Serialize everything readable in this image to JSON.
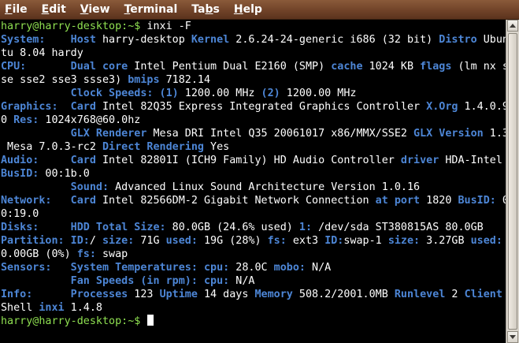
{
  "menu": {
    "items": [
      {
        "mnemonic": "F",
        "rest": "ile"
      },
      {
        "mnemonic": "E",
        "rest": "dit"
      },
      {
        "mnemonic": "V",
        "rest": "iew"
      },
      {
        "mnemonic": "T",
        "rest": "erminal"
      },
      {
        "mnemonic": "Tab",
        "rest": "s",
        "pre": "Ta",
        "ul": "b",
        "post": "s"
      },
      {
        "mnemonic": "H",
        "rest": "elp"
      }
    ]
  },
  "colors": {
    "background": "#000000",
    "text": "#ffffff",
    "key": "#4d86d6",
    "prompt": "#8fe051",
    "menubar": "#6e4127"
  },
  "terminal": {
    "lines": [
      [
        [
          "g",
          "harry@harry-desktop:~$"
        ],
        [
          "w",
          " inxi -F"
        ]
      ],
      [
        [
          "b",
          "System:    Host"
        ],
        [
          "w",
          " harry-desktop "
        ],
        [
          "b",
          "Kernel"
        ],
        [
          "w",
          " 2.6.24-24-generic i686 (32 bit) "
        ],
        [
          "b",
          "Distro"
        ],
        [
          "w",
          " Ubun"
        ]
      ],
      [
        [
          "w",
          "tu 8.04 hardy"
        ]
      ],
      [
        [
          "b",
          "CPU:       Dual core"
        ],
        [
          "w",
          " Intel Pentium Dual E2160 (SMP) "
        ],
        [
          "b",
          "cache"
        ],
        [
          "w",
          " 1024 KB "
        ],
        [
          "b",
          "flags"
        ],
        [
          "w",
          " (lm nx s"
        ]
      ],
      [
        [
          "w",
          "se sse2 sse3 ssse3) "
        ],
        [
          "b",
          "bmips"
        ],
        [
          "w",
          " 7182.14"
        ]
      ],
      [
        [
          "b",
          "           Clock Speeds: (1)"
        ],
        [
          "w",
          " 1200.00 MHz "
        ],
        [
          "b",
          "(2)"
        ],
        [
          "w",
          " 1200.00 MHz"
        ]
      ],
      [
        [
          "b",
          "Graphics:  Card"
        ],
        [
          "w",
          " Intel 82Q35 Express Integrated Graphics Controller "
        ],
        [
          "b",
          "X.Org"
        ],
        [
          "w",
          " 1.4.0.9"
        ]
      ],
      [
        [
          "w",
          "0 "
        ],
        [
          "b",
          "Res:"
        ],
        [
          "w",
          " 1024x768@60.0hz"
        ]
      ],
      [
        [
          "b",
          "           GLX Renderer"
        ],
        [
          "w",
          " Mesa DRI Intel Q35 20061017 x86/MMX/SSE2 "
        ],
        [
          "b",
          "GLX Version"
        ],
        [
          "w",
          " 1.3"
        ]
      ],
      [
        [
          "w",
          " Mesa 7.0.3-rc2 "
        ],
        [
          "b",
          "Direct Rendering"
        ],
        [
          "w",
          " Yes"
        ]
      ],
      [
        [
          "b",
          "Audio:     Card"
        ],
        [
          "w",
          " Intel 82801I (ICH9 Family) HD Audio Controller "
        ],
        [
          "b",
          "driver"
        ],
        [
          "w",
          " HDA-Intel"
        ]
      ],
      [
        [
          "b",
          "BusID:"
        ],
        [
          "w",
          " 00:1b.0"
        ]
      ],
      [
        [
          "b",
          "           Sound:"
        ],
        [
          "w",
          " Advanced Linux Sound Architecture Version 1.0.16"
        ]
      ],
      [
        [
          "b",
          "Network:   Card"
        ],
        [
          "w",
          " Intel 82566DM-2 Gigabit Network Connection "
        ],
        [
          "b",
          "at port"
        ],
        [
          "w",
          " 1820 "
        ],
        [
          "b",
          "BusID:"
        ],
        [
          "w",
          " 0"
        ]
      ],
      [
        [
          "w",
          "0:19.0"
        ]
      ],
      [
        [
          "b",
          "Disks:     HDD Total Size:"
        ],
        [
          "w",
          " 80.0GB (24.6% used) "
        ],
        [
          "b",
          "1:"
        ],
        [
          "w",
          " /dev/sda ST380815AS 80.0GB"
        ]
      ],
      [
        [
          "b",
          "Partition: ID:"
        ],
        [
          "w",
          "/ "
        ],
        [
          "b",
          "size:"
        ],
        [
          "w",
          " 71G "
        ],
        [
          "b",
          "used:"
        ],
        [
          "w",
          " 19G (28%) "
        ],
        [
          "b",
          "fs:"
        ],
        [
          "w",
          " ext3 "
        ],
        [
          "b",
          "ID:"
        ],
        [
          "w",
          "swap-1 "
        ],
        [
          "b",
          "size:"
        ],
        [
          "w",
          " 3.27GB "
        ],
        [
          "b",
          "used:"
        ]
      ],
      [
        [
          "w",
          "0.00GB (0%) "
        ],
        [
          "b",
          "fs:"
        ],
        [
          "w",
          " swap"
        ]
      ],
      [
        [
          "b",
          "Sensors:   System Temperatures: cpu:"
        ],
        [
          "w",
          " 28.0C "
        ],
        [
          "b",
          "mobo:"
        ],
        [
          "w",
          " N/A"
        ]
      ],
      [
        [
          "b",
          "           Fan Speeds (in rpm): cpu:"
        ],
        [
          "w",
          " N/A"
        ]
      ],
      [
        [
          "b",
          "Info:      Processes"
        ],
        [
          "w",
          " 123 "
        ],
        [
          "b",
          "Uptime"
        ],
        [
          "w",
          " 14 days "
        ],
        [
          "b",
          "Memory"
        ],
        [
          "w",
          " 508.2/2001.0MB "
        ],
        [
          "b",
          "Runlevel"
        ],
        [
          "w",
          " 2 "
        ],
        [
          "b",
          "Client"
        ]
      ],
      [
        [
          "w",
          "Shell "
        ],
        [
          "b",
          "inxi"
        ],
        [
          "w",
          " 1.4.8"
        ]
      ],
      [
        [
          "g",
          "harry@harry-desktop:~$"
        ],
        [
          "w",
          " "
        ]
      ]
    ]
  }
}
